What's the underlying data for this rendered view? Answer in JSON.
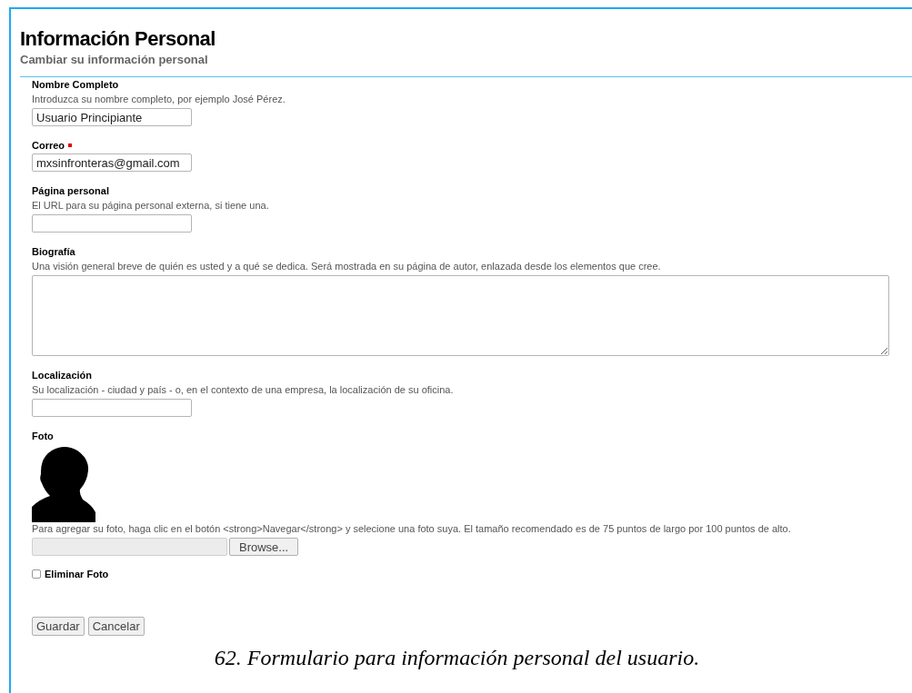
{
  "header": {
    "title": "Información Personal",
    "subtitle": "Cambiar su información personal"
  },
  "fields": [
    {
      "kind": "text",
      "label": "Nombre Completo",
      "required": false,
      "help": "Introduzca su nombre completo, por ejemplo José Pérez.",
      "value": "Usuario Principiante"
    },
    {
      "kind": "text",
      "label": "Correo",
      "required": true,
      "value": "mxsinfronteras@gmail.com"
    },
    {
      "kind": "text",
      "label": "Página personal",
      "required": false,
      "help": "El URL para su página personal externa, si tiene una."
    },
    {
      "kind": "textarea",
      "label": "Biografía",
      "required": false,
      "help": "Una visión general breve de quién es usted y a qué se dedica. Será mostrada en su página de autor, enlazada desde los elementos que cree."
    },
    {
      "kind": "text",
      "label": "Localización",
      "required": false,
      "help": "Su localización - ciudad y país - o, en el contexto de una empresa, la localización de su oficina."
    },
    {
      "kind": "photo",
      "label": "Foto",
      "required": false,
      "help": "Para agregar su foto, haga clic en el botón <strong>Navegar</strong> y selecione una foto suya. El tamaño recomendado es de 75 puntos de largo por 100 puntos de alto.",
      "button": "Browse..."
    },
    {
      "kind": "checkbox",
      "label": "Eliminar Foto",
      "required": false,
      "checked": false
    }
  ],
  "buttons": [
    "Guardar",
    "Cancelar"
  ],
  "caption": "62. Formulario para información personal del usuario."
}
